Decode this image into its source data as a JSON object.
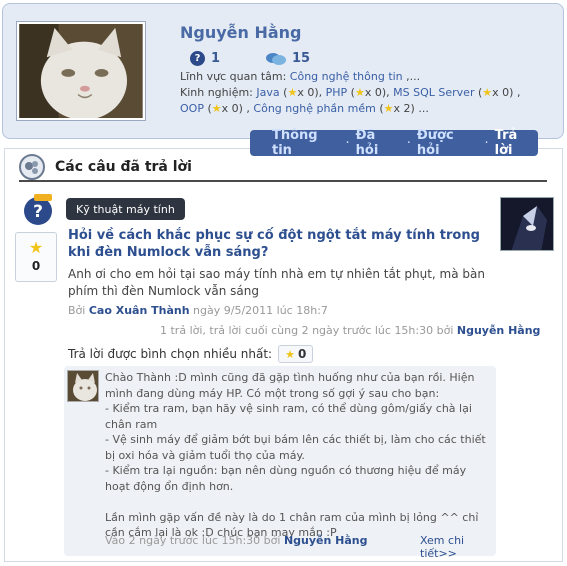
{
  "profile": {
    "name": "Nguyễn Hằng",
    "questions_count": "1",
    "answers_count": "15",
    "field_label": "Lĩnh vực quan tâm:",
    "field_value": "Công nghệ thông tin",
    "field_tail": ",...",
    "exp_label": "Kinh nghiệm:",
    "exp_items": [
      {
        "name": "Java",
        "count": "x 0"
      },
      {
        "name": "PHP",
        "count": "x 0"
      },
      {
        "name": "MS SQL Server",
        "count": "x 0"
      },
      {
        "name": "OOP",
        "count": "x 0"
      },
      {
        "name": "Công nghệ phần mềm",
        "count": "x 2"
      }
    ],
    "exp_tail": "..."
  },
  "tabs": [
    {
      "label": "Thông tin",
      "active": false
    },
    {
      "label": "Đã hỏi",
      "active": false
    },
    {
      "label": "Được hỏi",
      "active": false
    },
    {
      "label": "Trả lời",
      "active": true
    }
  ],
  "section": {
    "title": "Các câu đã trả lời"
  },
  "question": {
    "category": "Kỹ thuật máy tính",
    "votes": "0",
    "title": "Hỏi về cách khắc phục sự cố đột ngột tắt máy tính trong khi đèn Numlock vẫn sáng?",
    "body": "Anh ơi cho em hỏi tại sao máy tính nhà em tự nhiên tắt phụt, mà bàn phím thì đèn Numlock vẫn sáng",
    "by_prefix": "Bởi",
    "author": "Cao Xuân Thành",
    "date": "ngày 9/5/2011 lúc 18h:7",
    "meta": "1 trả lời, trả lời cuối cùng 2 ngày trước lúc 15h:30 bởi",
    "meta_author": "Nguyễn Hằng"
  },
  "best": {
    "label": "Trả lời được bình chọn nhiều nhất:",
    "votes": "0"
  },
  "answer": {
    "text": "Chào Thành :D mình cũng đã gặp tình huống như của bạn rồi. Hiện mình đang dùng máy HP. Có một trong số gợi ý sau cho bạn:\n- Kiểm tra ram, bạn hãy vệ sinh ram, có thể dùng gôm/giấy chà lại chân ram\n- Vệ sinh máy để giảm bớt bụi bám lên các thiết bị, làm cho các thiết bị oxi hóa và giảm tuổi thọ của máy.\n- Kiểm tra lại nguồn: bạn nên dùng nguồn có thương hiệu để máy hoạt động ổn định hơn.\n\nLần mình gặp vấn đề này là do 1 chân ram của mình bị lỏng ^^ chỉ cần cắm lại là ok :D chúc bạn may mắn :P",
    "foot": "Vào 2 ngày trước lúc 15h:30 bởi",
    "foot_author": "Nguyễn Hằng",
    "more": "Xem chi tiết>>"
  },
  "colors": {
    "accent": "#3f5f9e",
    "link": "#2d4f8f",
    "card_bg": "#e4ebf5"
  }
}
